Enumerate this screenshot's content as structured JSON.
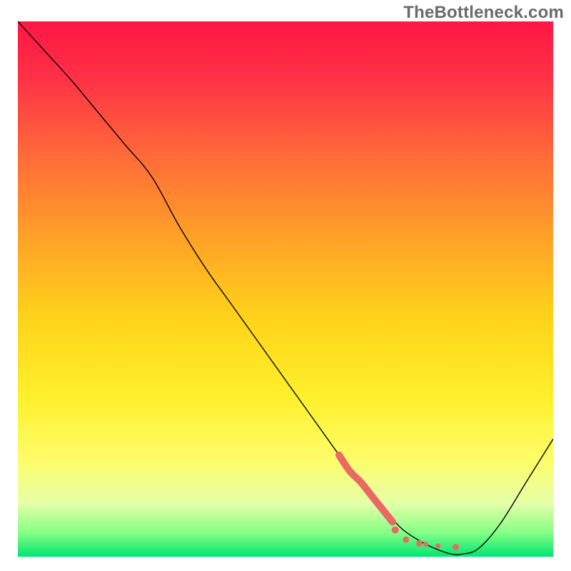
{
  "watermark": "TheBottleneck.com",
  "chart_data": {
    "type": "line",
    "title": "",
    "xlabel": "",
    "ylabel": "",
    "xlim": [
      0,
      100
    ],
    "ylim": [
      0,
      100
    ],
    "legend": false,
    "grid": false,
    "background_gradient_stops": [
      {
        "offset": 0.0,
        "color": "#ff1744"
      },
      {
        "offset": 0.1,
        "color": "#ff2f46"
      },
      {
        "offset": 0.25,
        "color": "#ff6a39"
      },
      {
        "offset": 0.4,
        "color": "#ffa028"
      },
      {
        "offset": 0.55,
        "color": "#ffd21a"
      },
      {
        "offset": 0.7,
        "color": "#fff02a"
      },
      {
        "offset": 0.82,
        "color": "#fdfd6a"
      },
      {
        "offset": 0.9,
        "color": "#e6ffa8"
      },
      {
        "offset": 0.955,
        "color": "#86ff86"
      },
      {
        "offset": 1.0,
        "color": "#00e571"
      }
    ],
    "series": [
      {
        "name": "bottleneck-curve",
        "color": "#000000",
        "stroke_width": 1.4,
        "x": [
          0,
          5,
          10,
          15,
          20,
          25,
          30,
          35,
          40,
          45,
          50,
          55,
          60,
          62,
          64,
          68,
          70,
          72,
          75,
          78,
          81,
          83,
          86,
          90,
          95,
          100
        ],
        "y": [
          100,
          94.5,
          89,
          83,
          77,
          71,
          62,
          54,
          47,
          40,
          33,
          26,
          19,
          16,
          14,
          9,
          7,
          5,
          3,
          1.5,
          0.5,
          0.5,
          1.5,
          6,
          14,
          22
        ]
      }
    ],
    "highlight": {
      "name": "optimal-range",
      "color": "#e96a64",
      "stroke_width": 10,
      "linecap": "round",
      "segments": [
        {
          "x": [
            60,
            62,
            64,
            66,
            68,
            70
          ],
          "y": [
            19,
            16,
            14,
            11.5,
            9,
            6.5
          ]
        }
      ],
      "dots": [
        {
          "x": 70.5,
          "y": 5.0,
          "r": 5.0
        },
        {
          "x": 72.5,
          "y": 3.2,
          "r": 4.4
        },
        {
          "x": 75.0,
          "y": 2.5,
          "r": 4.4
        },
        {
          "x": 76.2,
          "y": 2.3,
          "r": 3.6
        },
        {
          "x": 78.5,
          "y": 2.0,
          "r": 3.6
        },
        {
          "x": 81.8,
          "y": 1.8,
          "r": 4.4
        }
      ]
    }
  }
}
